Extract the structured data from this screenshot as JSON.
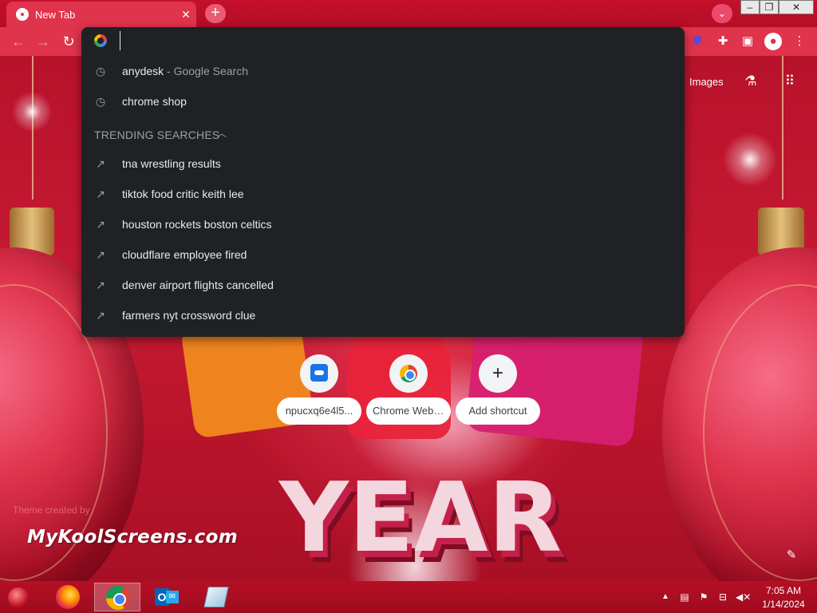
{
  "browser": {
    "tab_title": "New Tab",
    "tab_close_icon": "close-icon",
    "new_tab_icon": "plus-icon"
  },
  "omnibox": {
    "value": "",
    "placeholder": "",
    "suggestions": [
      {
        "icon": "history-icon",
        "text": "anydesk",
        "sub": " - Google Search"
      },
      {
        "icon": "history-icon",
        "text": "chrome shop",
        "sub": ""
      }
    ],
    "trending_header": "TRENDING SEARCHES",
    "trending": [
      {
        "icon": "trending-icon",
        "text": "tna wrestling results"
      },
      {
        "icon": "trending-icon",
        "text": "tiktok food critic keith lee"
      },
      {
        "icon": "trending-icon",
        "text": "houston rockets boston celtics"
      },
      {
        "icon": "trending-icon",
        "text": "cloudflare employee fired"
      },
      {
        "icon": "trending-icon",
        "text": "denver airport flights cancelled"
      },
      {
        "icon": "trending-icon",
        "text": "farmers nyt crossword clue"
      }
    ]
  },
  "ntp": {
    "images_link": "Images",
    "shortcuts": [
      {
        "label": "npucxq6e4l5...",
        "icon": "site-favicon"
      },
      {
        "label": "Chrome Web ...",
        "icon": "chrome-web-store-icon"
      },
      {
        "label": "Add shortcut",
        "icon": "plus-icon"
      }
    ],
    "theme_credit": "Theme created by",
    "brand": "MyKoolScreens.com",
    "background_words": {
      "year": "YEAR"
    }
  },
  "taskbar": {
    "time": "7:05 AM",
    "date": "1/14/2024"
  },
  "colors": {
    "accent": "#e0334c",
    "omnibox_bg": "#202124",
    "taskbar": "#b60f24"
  }
}
